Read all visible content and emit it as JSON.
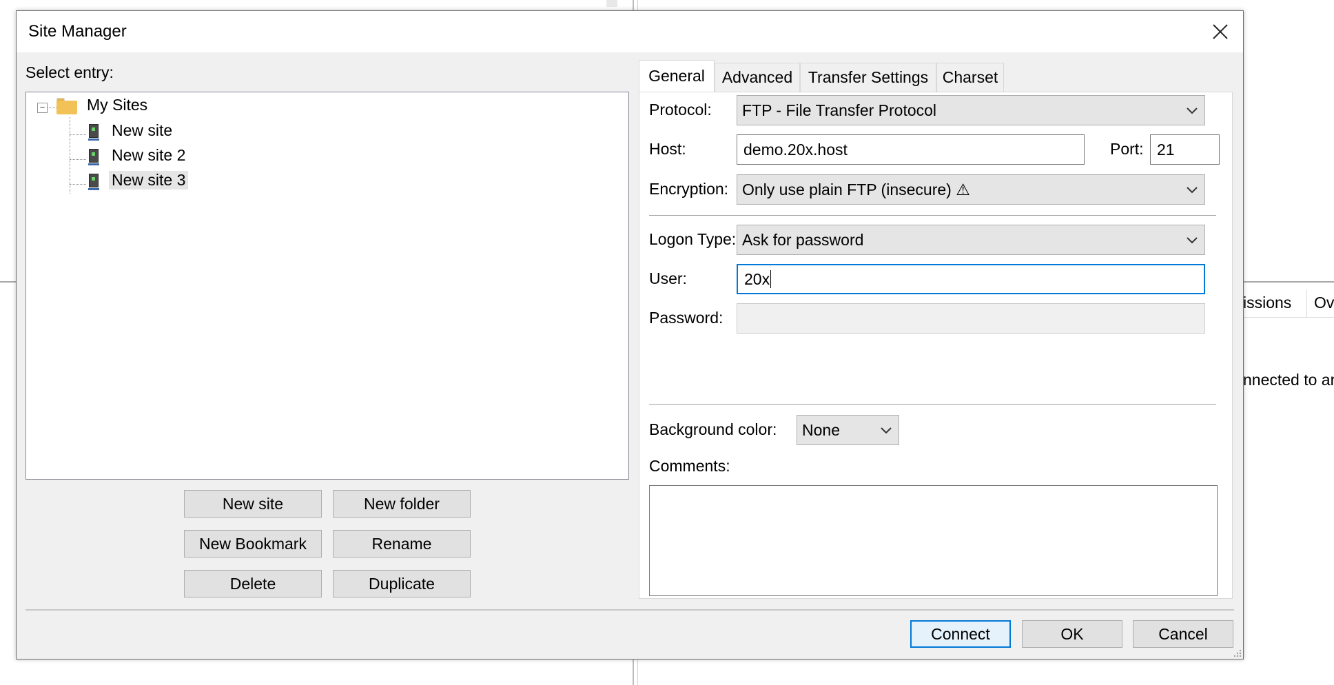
{
  "background": {
    "tab_a": "issions",
    "tab_b": "Ov",
    "log_text": "nnected to ar"
  },
  "dialog": {
    "title": "Site Manager",
    "close_glyph": "✕",
    "select_entry_label": "Select entry:",
    "tree": {
      "root": {
        "label": "My Sites",
        "expander": "−"
      },
      "sites": [
        {
          "label": "New site"
        },
        {
          "label": "New site 2"
        },
        {
          "label": "New site 3",
          "selected": true
        }
      ]
    },
    "buttons": {
      "new_site": "New site",
      "new_folder": "New folder",
      "new_bookmark": "New Bookmark",
      "rename": "Rename",
      "delete": "Delete",
      "duplicate": "Duplicate",
      "connect": "Connect",
      "ok": "OK",
      "cancel": "Cancel"
    },
    "tabs": [
      {
        "label": "General",
        "active": true
      },
      {
        "label": "Advanced"
      },
      {
        "label": "Transfer Settings"
      },
      {
        "label": "Charset"
      }
    ],
    "general": {
      "protocol_label": "Protocol:",
      "protocol_value": "FTP - File Transfer Protocol",
      "host_label": "Host:",
      "host_value": "demo.20x.host",
      "port_label": "Port:",
      "port_value": "21",
      "encryption_label": "Encryption:",
      "encryption_value": "Only use plain FTP (insecure) ⚠",
      "logon_type_label": "Logon Type:",
      "logon_type_value": "Ask for password",
      "user_label": "User:",
      "user_value": "20x",
      "password_label": "Password:",
      "password_value": "",
      "bg_color_label": "Background color:",
      "bg_color_value": "None",
      "comments_label": "Comments:",
      "comments_value": ""
    }
  },
  "colors": {
    "accent": "#0078d7",
    "dialog_bg": "#f0f0f0",
    "folder": "#f2c257"
  }
}
